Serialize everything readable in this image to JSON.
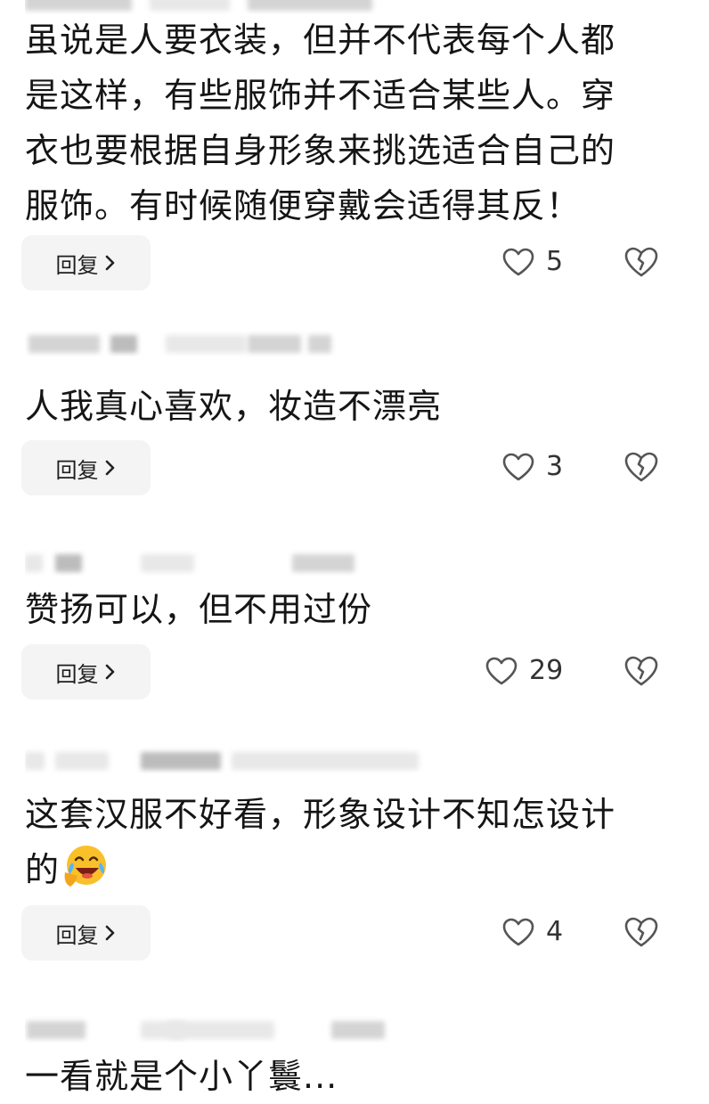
{
  "comments": [
    {
      "text_lines": [
        "虽说是人要衣装，但并不代表每个人都",
        "是这样，有些服饰并不适合某些人。穿",
        "衣也要根据自身形象来挑选适合自己的",
        "服饰。有时候随便穿戴会适得其反！"
      ],
      "reply_label": "回复",
      "likes": "5"
    },
    {
      "text_lines": [
        "人我真心喜欢，妆造不漂亮"
      ],
      "reply_label": "回复",
      "likes": "3"
    },
    {
      "text_lines": [
        "赞扬可以，但不用过份"
      ],
      "reply_label": "回复",
      "likes": "29"
    },
    {
      "text_lines": [
        "这套汉服不好看，形象设计不知怎设计",
        "的"
      ],
      "emoji": "laughing-crying-emoji",
      "reply_label": "回复",
      "likes": "4"
    },
    {
      "text_lines": [
        "一看就是个小丫鬟..."
      ]
    }
  ],
  "icons": {
    "like": "heart-outline-icon",
    "dislike": "broken-heart-icon",
    "reply_arrow": "chevron-right-icon"
  },
  "colors": {
    "reply_bg": "#f4f4f5",
    "icon": "#555555"
  }
}
